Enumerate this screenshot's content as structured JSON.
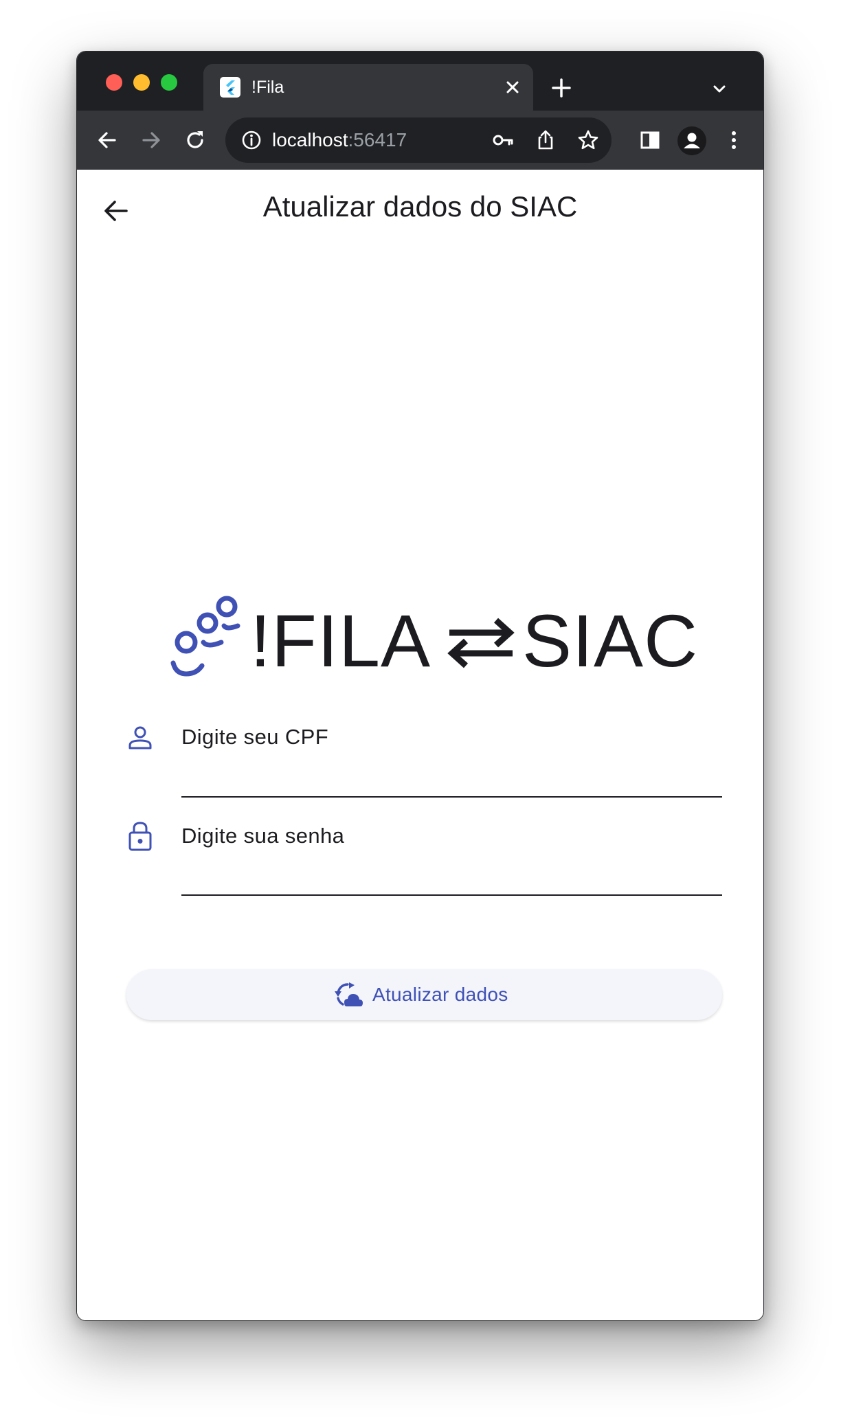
{
  "browser": {
    "tab": {
      "title": "!Fila",
      "favicon": "flutter-logo-icon"
    },
    "new_tab_icon": "plus-icon",
    "tab_dropdown_icon": "chevron-down-icon",
    "nav": {
      "back_icon": "arrow-left-icon",
      "forward_icon": "arrow-right-icon",
      "reload_icon": "reload-icon"
    },
    "address": {
      "site_info_icon": "info-icon",
      "host": "localhost",
      "port": ":56417"
    },
    "toolbar_icons": [
      "key-icon",
      "share-icon",
      "star-icon",
      "side-panel-icon",
      "profile-icon",
      "kebab-menu-icon"
    ]
  },
  "page": {
    "title": "Atualizar dados do SIAC",
    "back_icon": "arrow-left-icon",
    "logo": {
      "left_text": "!FILA",
      "right_text": "SIAC",
      "icon": "people-queue-icon",
      "swap_icon": "swap-arrows-icon"
    },
    "cpf_field": {
      "label": "Digite seu CPF",
      "icon": "person-icon"
    },
    "password_field": {
      "label": "Digite sua senha",
      "icon": "lock-icon"
    },
    "submit_button": {
      "label": "Atualizar dados",
      "icon": "cloud-sync-icon"
    }
  },
  "colors": {
    "accent": "#3f51b5",
    "chrome_dark": "#1f2023",
    "chrome_toolbar": "#35363a",
    "text": "#1c1b1f"
  }
}
